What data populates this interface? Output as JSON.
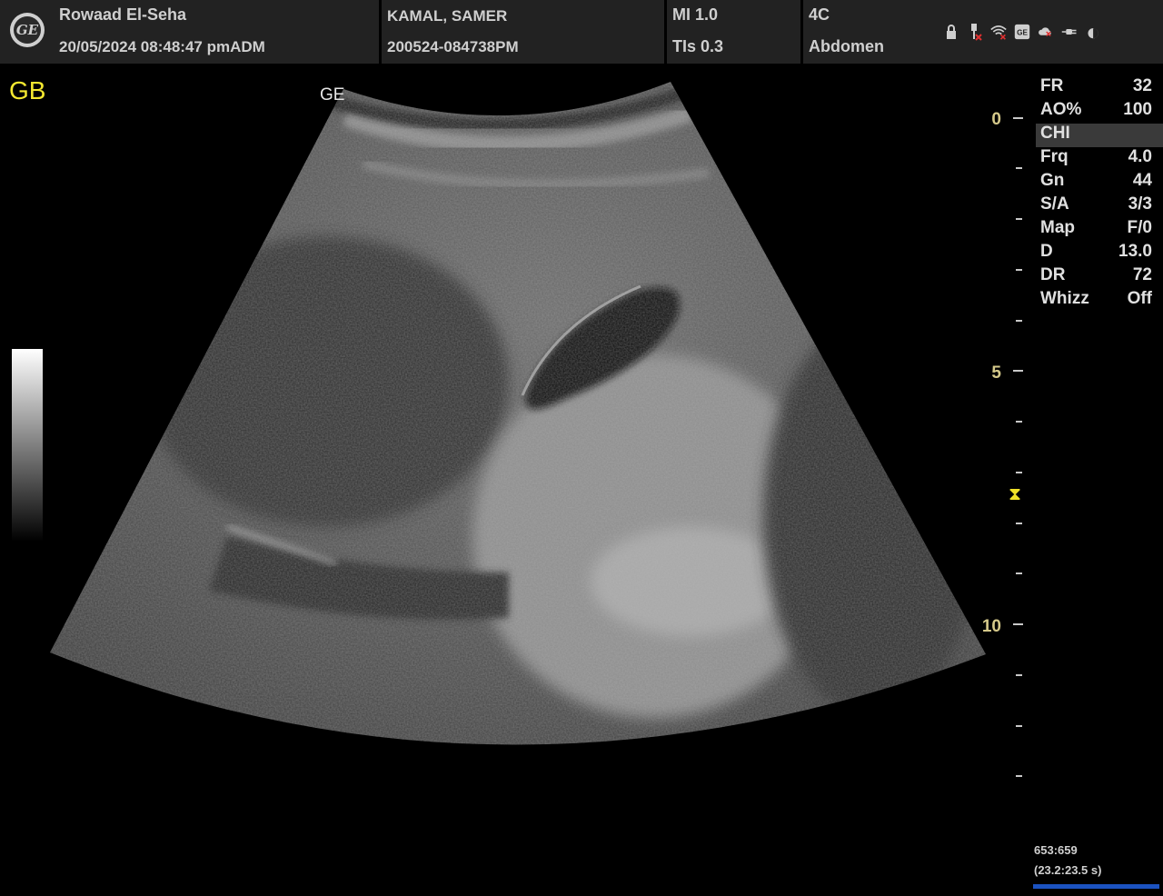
{
  "header": {
    "logo": "ge-logo",
    "logo_text": "GE",
    "institution": "Rowaad El-Seha",
    "datetime": "20/05/2024 08:48:47 pm",
    "operator": "ADM",
    "patient_name": "KAMAL, SAMER",
    "exam_id": "200524-084738PM",
    "mi": "MI 1.0",
    "tis": "TIs 0.3",
    "probe": "4C",
    "preset": "Abdomen",
    "icons": [
      "lock-icon",
      "usb-disconnected-icon",
      "wifi-disconnected-icon",
      "ge-service-icon",
      "cloud-disconnected-icon",
      "power-plug-icon",
      "contrast-icon"
    ],
    "icon_symbols": {
      "ge": "GE",
      "contrast": "◐"
    }
  },
  "image": {
    "annotation": "GB",
    "probe_marker": "GE",
    "depth_labels": [
      "0",
      "5",
      "10"
    ],
    "focus_marker": "⧗"
  },
  "params": [
    {
      "k": "FR",
      "v": "32"
    },
    {
      "k": "AO%",
      "v": "100"
    },
    {
      "k": "CHI",
      "v": ""
    },
    {
      "k": "Frq",
      "v": "4.0"
    },
    {
      "k": "Gn",
      "v": "44"
    },
    {
      "k": "S/A",
      "v": "3/3"
    },
    {
      "k": "Map",
      "v": "F/0"
    },
    {
      "k": "D",
      "v": "13.0"
    },
    {
      "k": "DR",
      "v": "72"
    },
    {
      "k": "Whizz",
      "v": "Off"
    }
  ],
  "cine": {
    "frame": "653:659",
    "time": "(23.2:23.5 s)",
    "progress": 0.99
  },
  "colors": {
    "annotation": "#f4e830",
    "depth": "#d5c98a",
    "progress": "#1b52c0"
  }
}
